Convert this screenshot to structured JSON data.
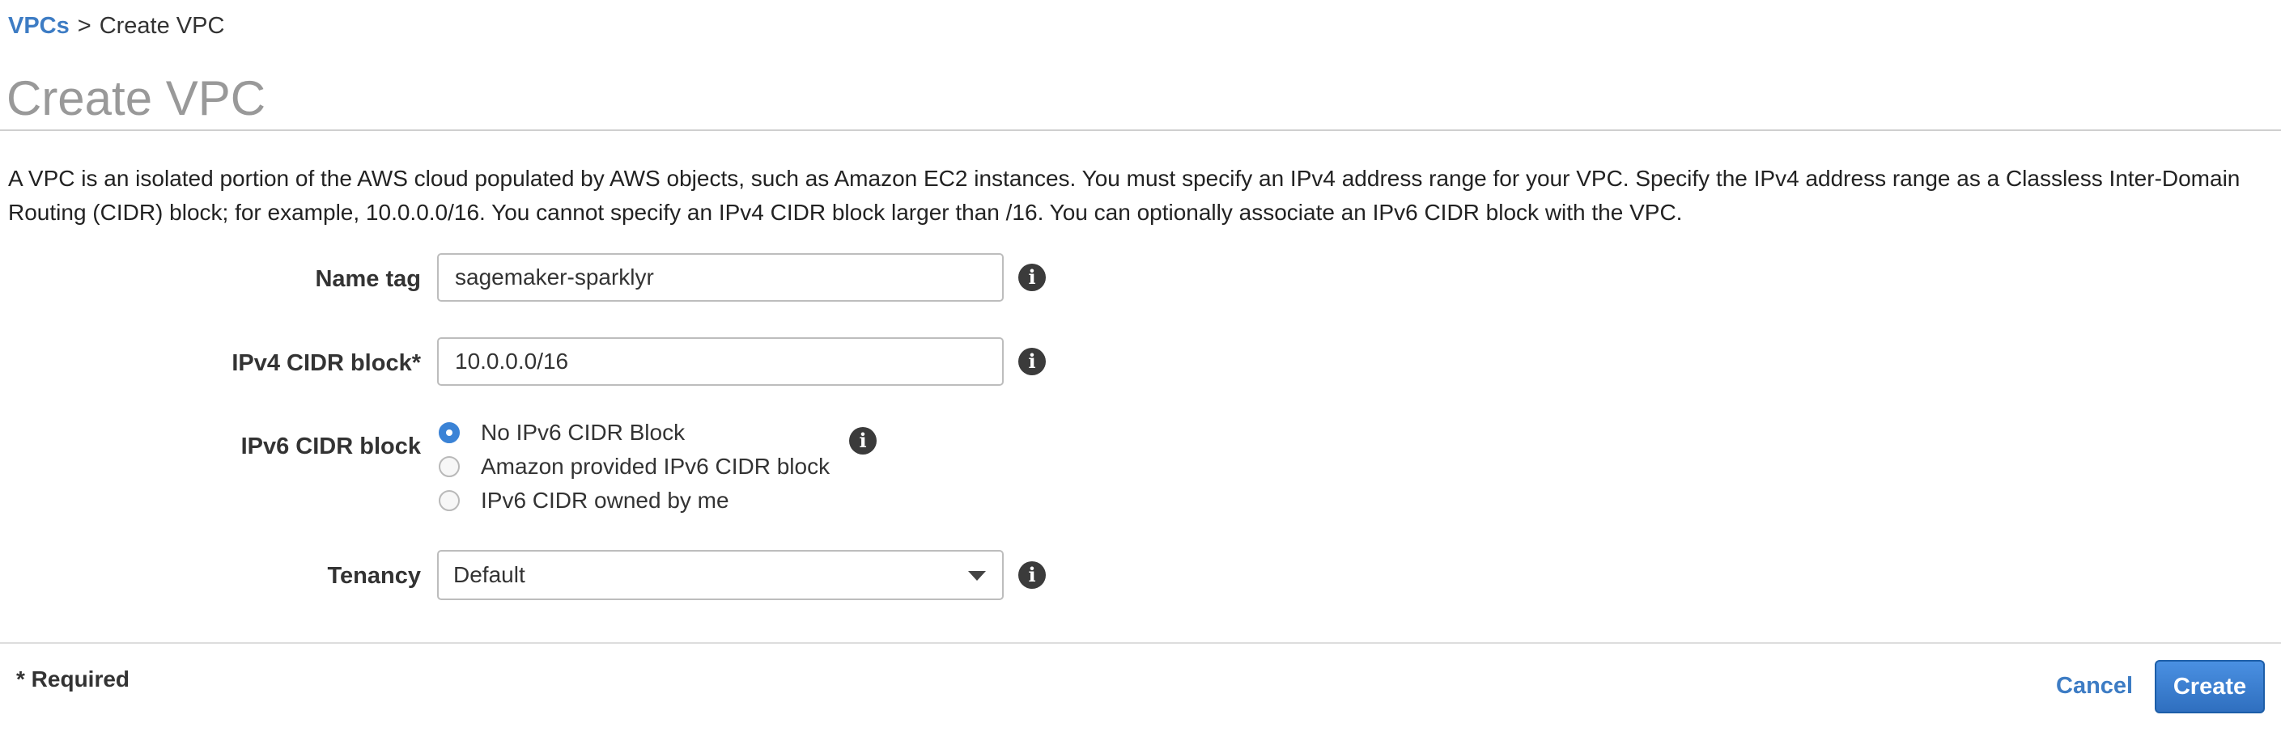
{
  "breadcrumb": {
    "parent": "VPCs",
    "separator": ">",
    "current": "Create VPC"
  },
  "page": {
    "title": "Create VPC",
    "description": "A VPC is an isolated portion of the AWS cloud populated by AWS objects, such as Amazon EC2 instances. You must specify an IPv4 address range for your VPC. Specify the IPv4 address range as a Classless Inter-Domain Routing (CIDR) block; for example, 10.0.0.0/16. You cannot specify an IPv4 CIDR block larger than /16. You can optionally associate an IPv6 CIDR block with the VPC."
  },
  "form": {
    "name_tag": {
      "label": "Name tag",
      "value": "sagemaker-sparklyr",
      "info_icon": "info-icon"
    },
    "ipv4_cidr": {
      "label": "IPv4 CIDR block*",
      "value": "10.0.0.0/16",
      "info_icon": "info-icon"
    },
    "ipv6_cidr": {
      "label": "IPv6 CIDR block",
      "options": [
        {
          "label": "No IPv6 CIDR Block",
          "selected": true
        },
        {
          "label": "Amazon provided IPv6 CIDR block",
          "selected": false
        },
        {
          "label": "IPv6 CIDR owned by me",
          "selected": false
        }
      ],
      "info_icon": "info-icon"
    },
    "tenancy": {
      "label": "Tenancy",
      "selected": "Default",
      "info_icon": "info-icon"
    }
  },
  "footer": {
    "required_note": "* Required",
    "cancel_label": "Cancel",
    "create_label": "Create"
  },
  "colors": {
    "link": "#3d7cc4",
    "title": "#999999",
    "primary_button": "#2f6fbf",
    "radio_selected": "#3b83d6"
  }
}
